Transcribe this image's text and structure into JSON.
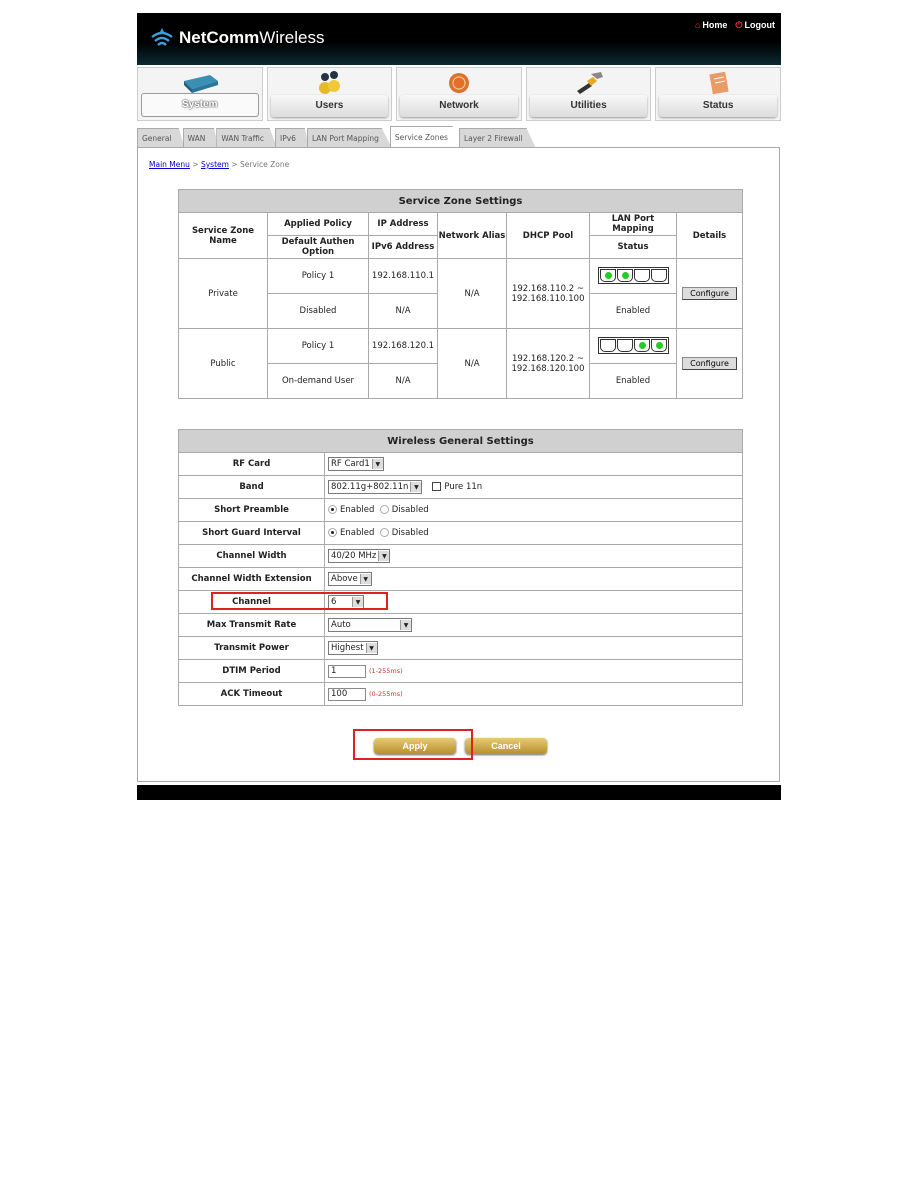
{
  "header": {
    "brand_bold": "NetComm",
    "brand_light": "Wireless",
    "home_label": "Home",
    "logout_label": "Logout"
  },
  "nav": [
    {
      "label": "System",
      "icon": "router-icon",
      "active": true
    },
    {
      "label": "Users",
      "icon": "users-icon"
    },
    {
      "label": "Network",
      "icon": "network-globe-icon"
    },
    {
      "label": "Utilities",
      "icon": "hammer-icon"
    },
    {
      "label": "Status",
      "icon": "notepad-icon"
    }
  ],
  "tabs": [
    "General",
    "WAN",
    "WAN Traffic",
    "IPv6",
    "LAN Port Mapping",
    "Service Zones",
    "Layer 2 Firewall"
  ],
  "active_tab": "Service Zones",
  "breadcrumb": {
    "main": "Main Menu",
    "system": "System",
    "sep": ">",
    "current": "Service Zone"
  },
  "service_zone": {
    "title": "Service Zone Settings",
    "headers": {
      "name": "Service Zone Name",
      "applied_policy": "Applied Policy",
      "default_authen": "Default Authen Option",
      "ip": "IP Address",
      "ipv6": "IPv6 Address",
      "alias": "Network Alias",
      "dhcp": "DHCP Pool",
      "lan_port": "LAN Port Mapping",
      "status": "Status",
      "details": "Details"
    },
    "rows": [
      {
        "name": "Private",
        "policy": "Policy 1",
        "authen": "Disabled",
        "ip": "192.168.110.1",
        "ipv6": "N/A",
        "alias": "N/A",
        "dhcp_start": "192.168.110.2 ~",
        "dhcp_end": "192.168.110.100",
        "ports": [
          true,
          true,
          false,
          false
        ],
        "status": "Enabled",
        "button": "Configure"
      },
      {
        "name": "Public",
        "policy": "Policy 1",
        "authen": "On-demand User",
        "ip": "192.168.120.1",
        "ipv6": "N/A",
        "alias": "N/A",
        "dhcp_start": "192.168.120.2 ~",
        "dhcp_end": "192.168.120.100",
        "ports": [
          false,
          false,
          true,
          true
        ],
        "status": "Enabled",
        "button": "Configure"
      }
    ]
  },
  "wireless": {
    "title": "Wireless General Settings",
    "rf_card": {
      "label": "RF Card",
      "value": "RF Card1"
    },
    "band": {
      "label": "Band",
      "value": "802.11g+802.11n",
      "pure_label": "Pure 11n",
      "pure_checked": false
    },
    "short_preamble": {
      "label": "Short Preamble",
      "enabled": "Enabled",
      "disabled": "Disabled",
      "selected": "Enabled"
    },
    "short_guard": {
      "label": "Short Guard Interval",
      "enabled": "Enabled",
      "disabled": "Disabled",
      "selected": "Enabled"
    },
    "channel_width": {
      "label": "Channel Width",
      "value": "40/20 MHz"
    },
    "channel_width_ext": {
      "label": "Channel Width Extension",
      "value": "Above"
    },
    "channel": {
      "label": "Channel",
      "value": "6"
    },
    "max_rate": {
      "label": "Max Transmit Rate",
      "value": "Auto"
    },
    "tx_power": {
      "label": "Transmit Power",
      "value": "Highest"
    },
    "dtim": {
      "label": "DTIM Period",
      "value": "1",
      "hint": "(1-255ms)"
    },
    "ack": {
      "label": "ACK Timeout",
      "value": "100",
      "hint": "(0-255ms)"
    }
  },
  "buttons": {
    "apply": "Apply",
    "cancel": "Cancel"
  },
  "colors": {
    "highlight": "#dd2222",
    "button_gold": "#c9a23f",
    "port_on": "#22cc22"
  }
}
